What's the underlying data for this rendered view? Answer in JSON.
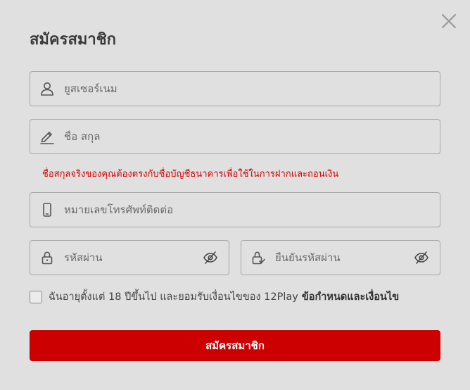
{
  "title": "สมัครสมาชิก",
  "close_icon": "close-icon",
  "fields": {
    "username": {
      "placeholder": "ยูสเซอร์เนม",
      "value": "",
      "icon": "user-icon"
    },
    "fullname": {
      "placeholder": "ชื่อ สกุล",
      "value": "",
      "icon": "pen-icon"
    },
    "phone": {
      "placeholder": "หมายเลขโทรศัพท์ติดต่อ",
      "value": "",
      "icon": "phone-icon"
    },
    "password": {
      "placeholder": "รหัสผ่าน",
      "value": "",
      "icon": "lock-icon"
    },
    "confirm_password": {
      "placeholder": "ยืนยันรหัสผ่าน",
      "value": "",
      "icon": "lock-check-icon"
    }
  },
  "name_hint": "ชื่อสกุลจริงของคุณต้องตรงกับชื่อบัญชีธนาคารเพื่อใช้ในการฝากและถอนเงิน",
  "terms": {
    "text": "ฉันอายุตั้งแต่ 18 ปีขึ้นไป และยอมรับเงื่อนไขของ 12Play",
    "link": "ข้อกำหนดและเงื่อนไข",
    "checked": false
  },
  "submit_label": "สมัครสมาชิก",
  "colors": {
    "background": "#e0e0e0",
    "primary": "#cc0000",
    "hint": "#d40000",
    "border": "#a8a8a8"
  }
}
